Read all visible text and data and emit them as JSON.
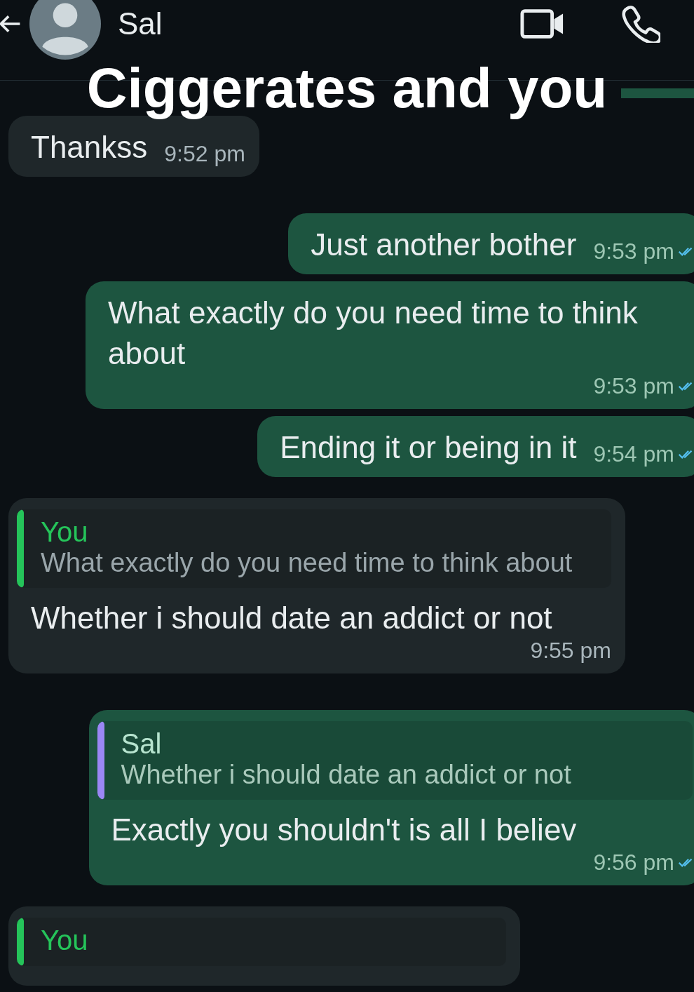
{
  "header": {
    "contact": "Sal"
  },
  "caption": "Ciggerates and you",
  "messages": [
    {
      "kind": "incoming",
      "text": "Thankss",
      "time": "9:52 pm"
    },
    {
      "kind": "outgoing",
      "text": "Just another bother",
      "time": "9:53 pm",
      "read": true
    },
    {
      "kind": "outgoing",
      "text": "What exactly do you need time to think about",
      "time": "9:53 pm",
      "read": true
    },
    {
      "kind": "outgoing",
      "text": "Ending it or being in it",
      "time": "9:54 pm",
      "read": true
    },
    {
      "kind": "incoming",
      "quote": {
        "author": "You",
        "text": "What exactly do you need time to think about",
        "color": "#25c45a"
      },
      "text": "Whether i should date an addict or not",
      "time": "9:55 pm"
    },
    {
      "kind": "outgoing",
      "quote": {
        "author": "Sal",
        "text": "Whether i should date an addict or not",
        "color": "#9b87f5"
      },
      "text": "Exactly you shouldn't is all I believ",
      "time": "9:56 pm",
      "read": true
    },
    {
      "kind": "incoming",
      "quote": {
        "author": "You",
        "color": "#25c45a"
      }
    }
  ]
}
